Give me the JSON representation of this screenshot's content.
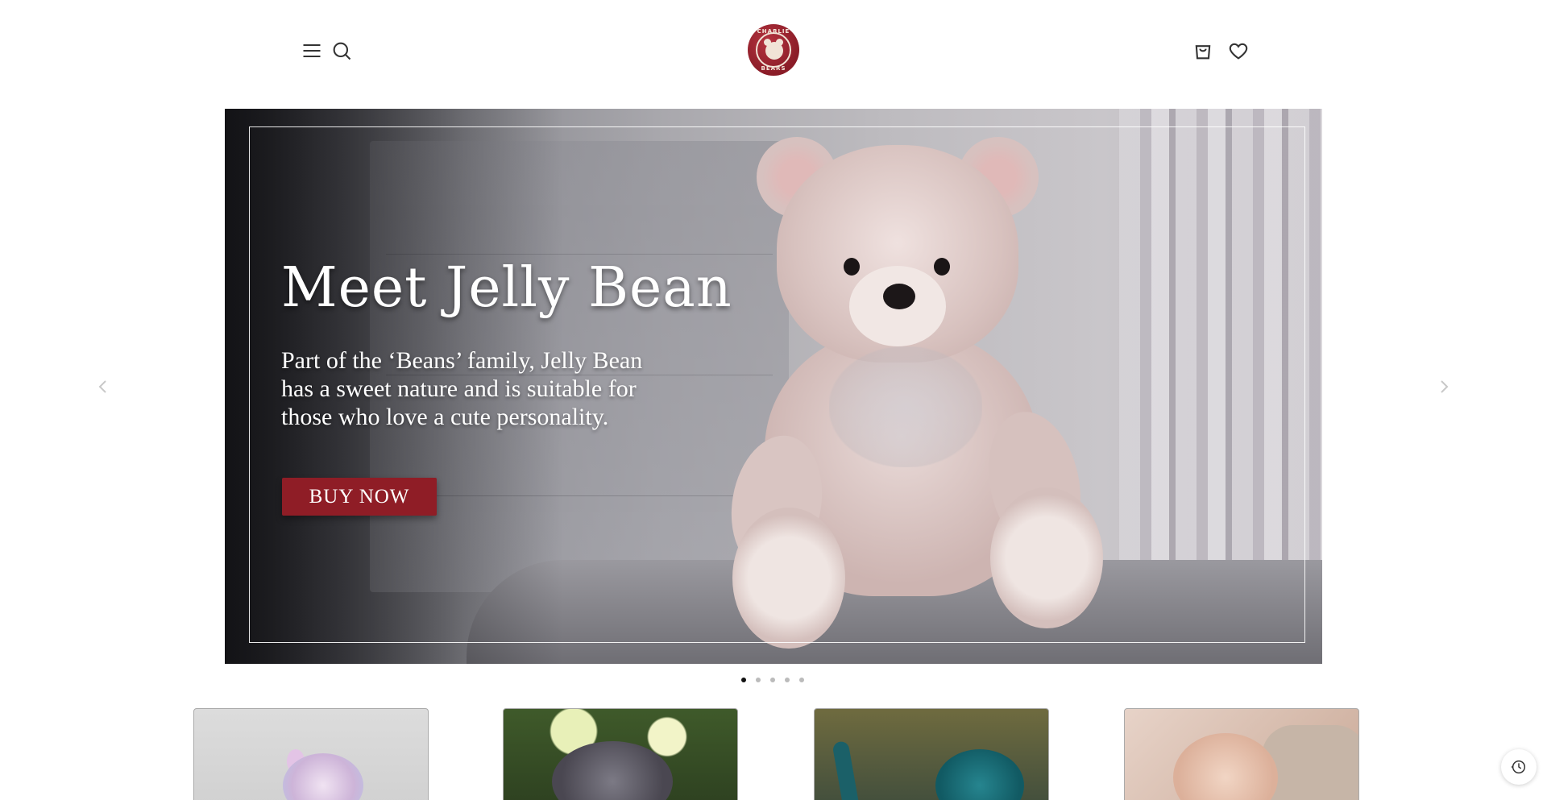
{
  "header": {
    "menu_icon": "hamburger-menu-icon",
    "search_icon": "search-icon",
    "bag_icon": "shopping-bag-icon",
    "wishlist_icon": "heart-icon",
    "logo_top": "CHARLIE",
    "logo_bottom": "BEARS"
  },
  "hero": {
    "title": "Meet Jelly Bean",
    "text": "Part of the ‘Beans’ family, Jelly Bean has a sweet nature and is suitable for those who love a cute personality.",
    "cta_label": "BUY NOW",
    "prev_icon": "chevron-left-icon",
    "next_icon": "chevron-right-icon",
    "slide_count": 5,
    "active_slide": 1
  },
  "products": [
    {
      "name": "bunny-plush"
    },
    {
      "name": "grey-creature-plush"
    },
    {
      "name": "teal-dragon-plush"
    },
    {
      "name": "baby-with-bear"
    }
  ],
  "floating": {
    "history_icon": "recently-viewed-clock-icon"
  },
  "colors": {
    "brand_red": "#8f1d26",
    "text_white": "#ffffff",
    "dot_active": "#111111",
    "dot_inactive": "#bbbbbb"
  }
}
